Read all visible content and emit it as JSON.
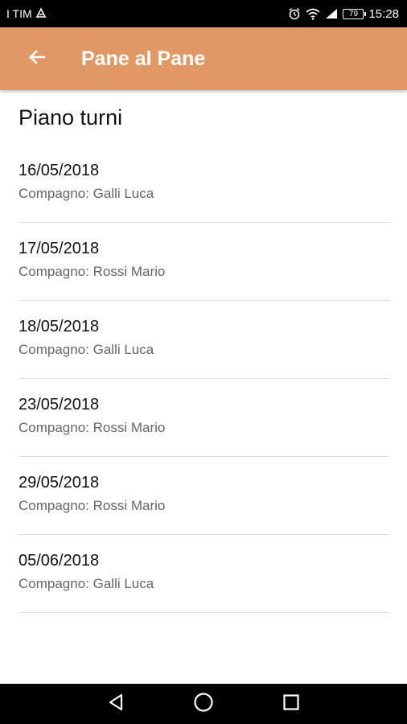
{
  "status_bar": {
    "carrier": "I TIM",
    "battery": "79",
    "time": "15:28"
  },
  "app_bar": {
    "title": "Pane al Pane"
  },
  "section": {
    "title": "Piano turni"
  },
  "shifts": [
    {
      "date": "16/05/2018",
      "partner": "Compagno: Galli Luca"
    },
    {
      "date": "17/05/2018",
      "partner": "Compagno: Rossi Mario"
    },
    {
      "date": "18/05/2018",
      "partner": "Compagno: Galli Luca"
    },
    {
      "date": "23/05/2018",
      "partner": "Compagno: Rossi Mario"
    },
    {
      "date": "29/05/2018",
      "partner": "Compagno: Rossi Mario"
    },
    {
      "date": "05/06/2018",
      "partner": "Compagno: Galli Luca"
    }
  ],
  "colors": {
    "app_bar": "#e09866",
    "status_bar": "#000000",
    "nav_bar": "#000000"
  },
  "icons": {
    "back": "arrow-back-icon",
    "nav_back": "triangle-back-icon",
    "nav_home": "circle-home-icon",
    "nav_recents": "square-recents-icon"
  }
}
